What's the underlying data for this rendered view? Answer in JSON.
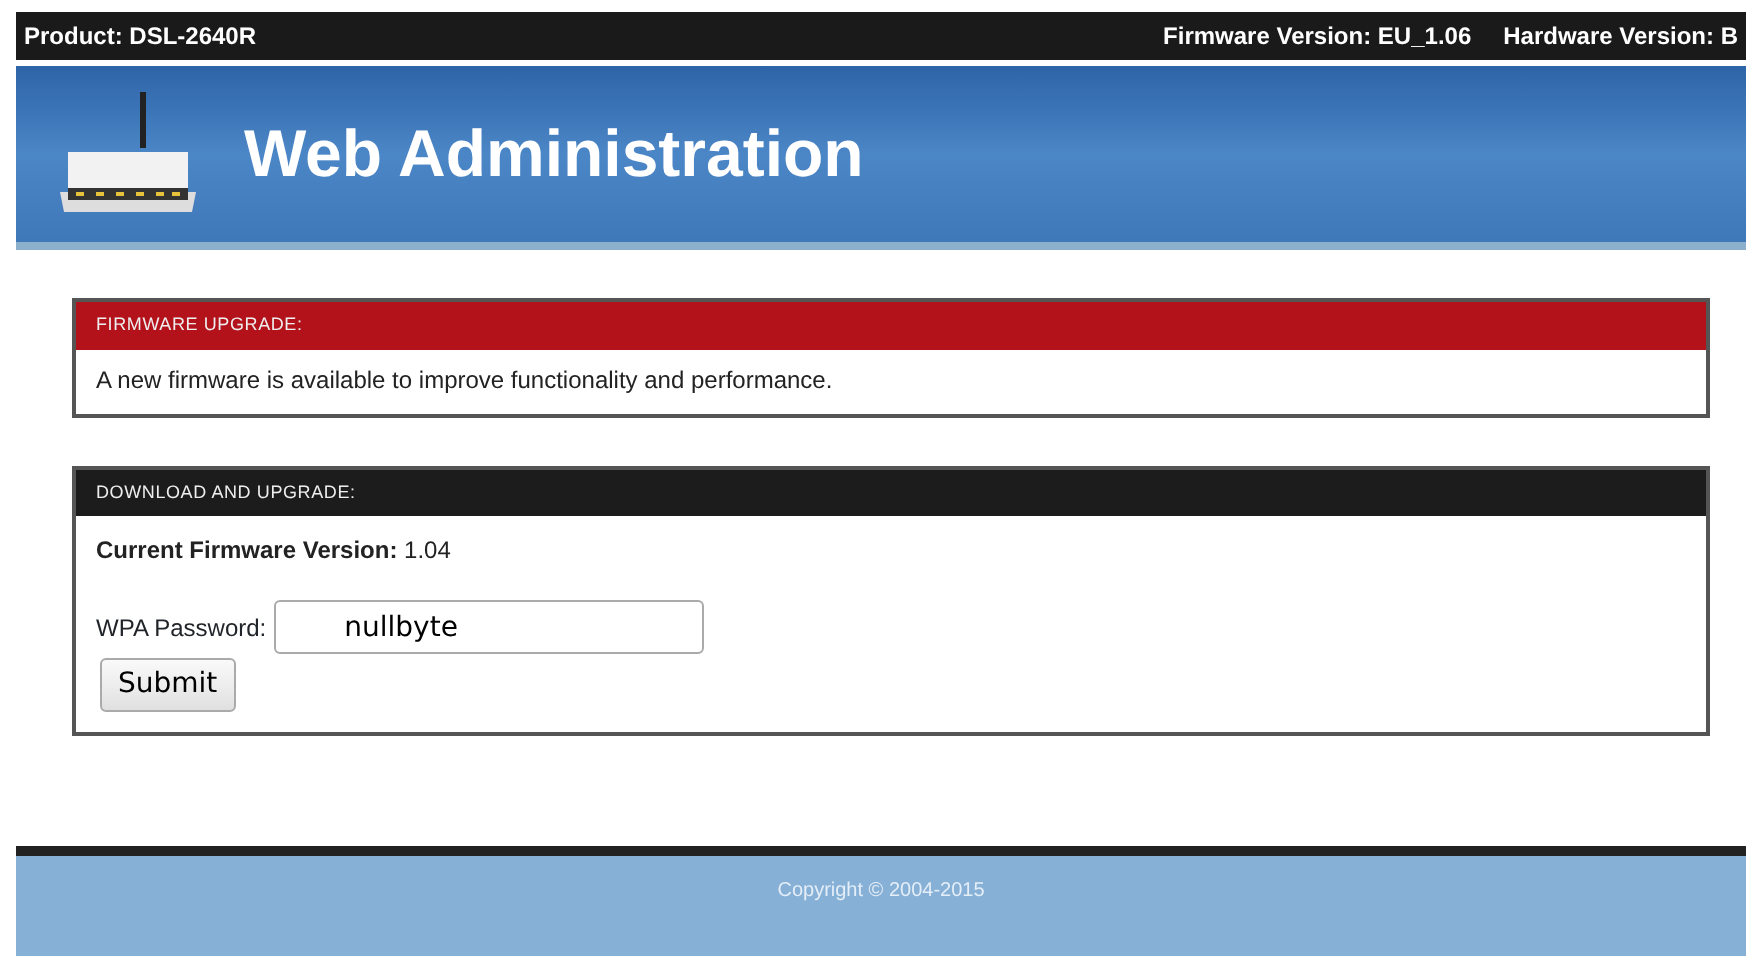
{
  "top_bar": {
    "product": "Product: DSL-2640R",
    "firmware": "Firmware Version: EU_1.06",
    "hardware": "Hardware Version: B"
  },
  "header": {
    "title": "Web Administration"
  },
  "sections": [
    {
      "heading": "FIRMWARE UPGRADE:",
      "kind": "alert",
      "text": "A new firmware is available to improve functionality and performance."
    },
    {
      "heading": "DOWNLOAD AND UPGRADE:",
      "kind": "form",
      "current": "**Current Firmware Version:** 1.04",
      "field_label": "WPA Password:",
      "field_value": "nullbyte",
      "button": "Submit"
    }
  ],
  "footer": {
    "copyright": "Copyright © 2004-2015"
  }
}
